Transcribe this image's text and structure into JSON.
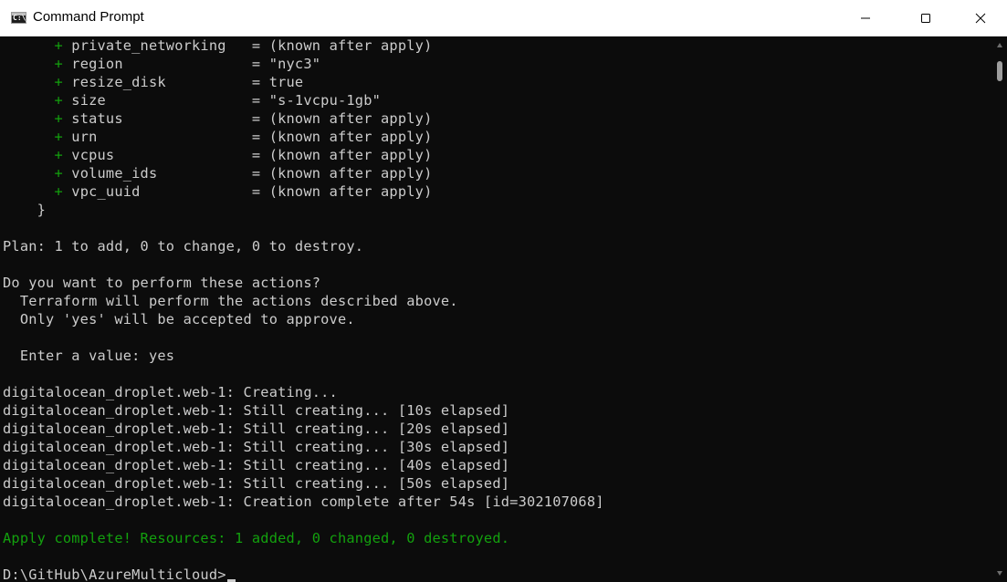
{
  "window": {
    "title": "Command Prompt",
    "app_icon_glyph": "C:\\_"
  },
  "controls": {
    "minimize_icon": "minimize-icon",
    "maximize_icon": "maximize-icon",
    "close_icon": "close-icon"
  },
  "terminal": {
    "lines": [
      {
        "prefix": "      + ",
        "text": "private_networking   = (known after apply)"
      },
      {
        "prefix": "      + ",
        "text": "region               = \"nyc3\""
      },
      {
        "prefix": "      + ",
        "text": "resize_disk          = true"
      },
      {
        "prefix": "      + ",
        "text": "size                 = \"s-1vcpu-1gb\""
      },
      {
        "prefix": "      + ",
        "text": "status               = (known after apply)"
      },
      {
        "prefix": "      + ",
        "text": "urn                  = (known after apply)"
      },
      {
        "prefix": "      + ",
        "text": "vcpus                = (known after apply)"
      },
      {
        "prefix": "      + ",
        "text": "volume_ids           = (known after apply)"
      },
      {
        "prefix": "      + ",
        "text": "vpc_uuid             = (known after apply)"
      },
      {
        "prefix": "",
        "text": "    }"
      },
      {
        "prefix": "",
        "text": ""
      },
      {
        "prefix": "",
        "text": "Plan: 1 to add, 0 to change, 0 to destroy."
      },
      {
        "prefix": "",
        "text": ""
      },
      {
        "prefix": "",
        "text": "Do you want to perform these actions?"
      },
      {
        "prefix": "",
        "text": "  Terraform will perform the actions described above."
      },
      {
        "prefix": "",
        "text": "  Only 'yes' will be accepted to approve."
      },
      {
        "prefix": "",
        "text": ""
      },
      {
        "prefix": "",
        "text": "  Enter a value: yes"
      },
      {
        "prefix": "",
        "text": ""
      },
      {
        "prefix": "",
        "text": "digitalocean_droplet.web-1: Creating..."
      },
      {
        "prefix": "",
        "text": "digitalocean_droplet.web-1: Still creating... [10s elapsed]"
      },
      {
        "prefix": "",
        "text": "digitalocean_droplet.web-1: Still creating... [20s elapsed]"
      },
      {
        "prefix": "",
        "text": "digitalocean_droplet.web-1: Still creating... [30s elapsed]"
      },
      {
        "prefix": "",
        "text": "digitalocean_droplet.web-1: Still creating... [40s elapsed]"
      },
      {
        "prefix": "",
        "text": "digitalocean_droplet.web-1: Still creating... [50s elapsed]"
      },
      {
        "prefix": "",
        "text": "digitalocean_droplet.web-1: Creation complete after 54s [id=302107068]"
      },
      {
        "prefix": "",
        "text": ""
      },
      {
        "prefix": "",
        "text": "Apply complete! Resources: 1 added, 0 changed, 0 destroyed.",
        "green": true
      },
      {
        "prefix": "",
        "text": ""
      },
      {
        "prefix": "",
        "text": "D:\\GitHub\\AzureMulticloud>",
        "prompt": true
      }
    ]
  },
  "colors": {
    "background": "#0c0c0c",
    "foreground": "#cccccc",
    "green": "#13a10e",
    "titlebar": "#ffffff"
  }
}
